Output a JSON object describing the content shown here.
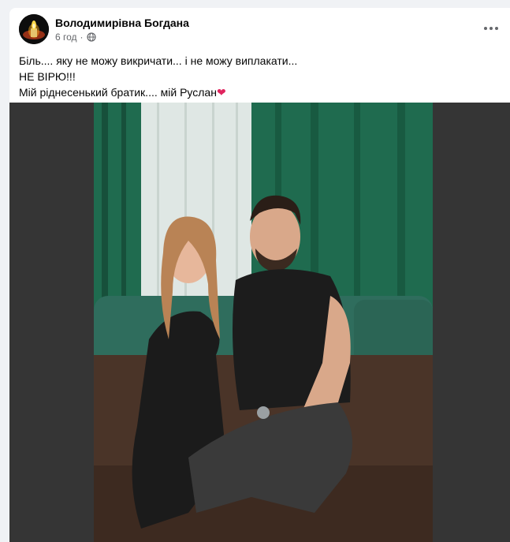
{
  "post": {
    "author": "Володимирівна Богдана",
    "time": "6 год",
    "visibility_icon": "globe-icon",
    "more_icon": "more-options-icon",
    "lines": [
      "Біль.... яку не можу викричати... і не можу виплакати...",
      "НЕ ВІРЮ!!!",
      "Мій ріднесенький братик.... мій Руслан"
    ],
    "heart": "❤",
    "colors": {
      "heart": "#e0245e",
      "curtain": "#1f6b4f",
      "sofa": "#2f6d5d",
      "background": "#353535"
    }
  }
}
